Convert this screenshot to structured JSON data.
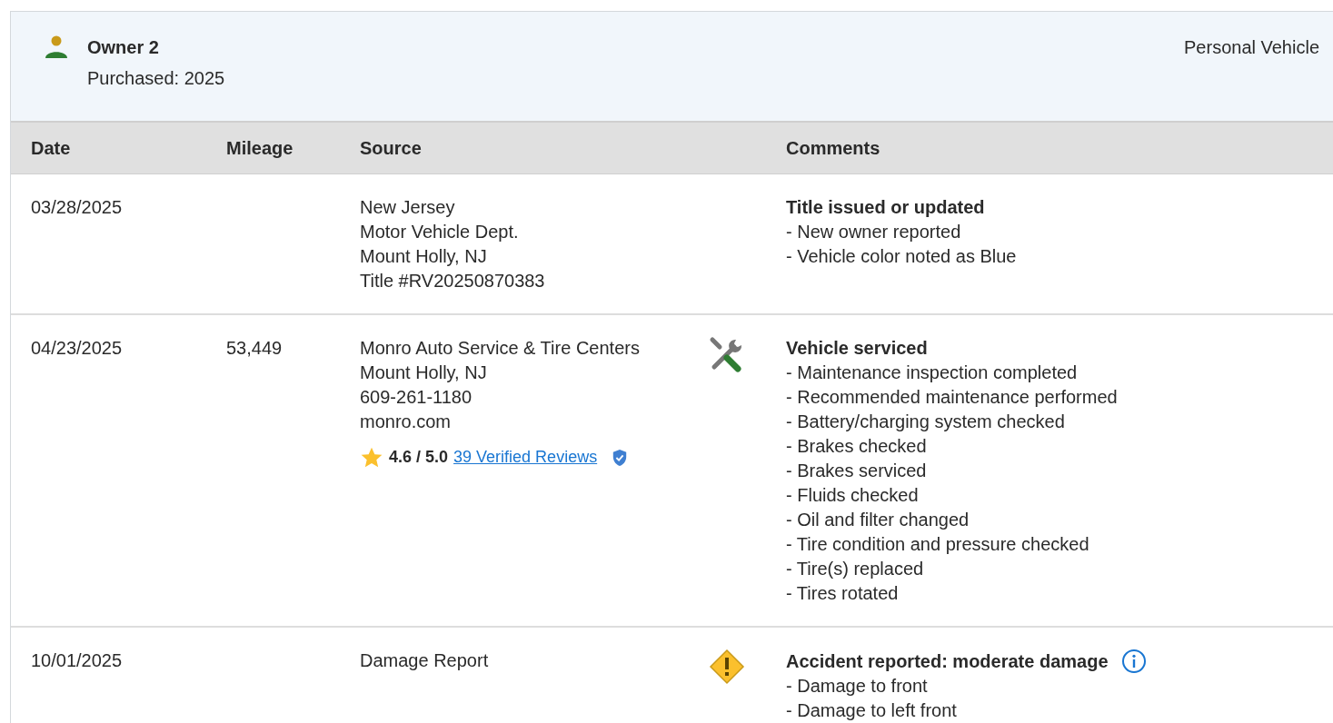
{
  "owner": {
    "title": "Owner 2",
    "purchased": "Purchased: 2025",
    "vehicle_type": "Personal Vehicle"
  },
  "table": {
    "columns": [
      "Date",
      "Mileage",
      "Source",
      "Comments"
    ],
    "rows": [
      {
        "date": "03/28/2025",
        "mileage": "",
        "source": [
          "New Jersey",
          "Motor Vehicle Dept.",
          "Mount Holly, NJ",
          "Title #RV20250870383"
        ],
        "kind": "title",
        "comment_title": "Title issued or updated",
        "comments": [
          "- New owner reported",
          "- Vehicle color noted as Blue"
        ]
      },
      {
        "date": "04/23/2025",
        "mileage": "53,449",
        "source": [
          "Monro Auto Service & Tire Centers",
          "Mount Holly, NJ",
          "609-261-1180",
          "monro.com"
        ],
        "rating": {
          "score": "4.6 / 5.0",
          "reviews": "39 Verified Reviews"
        },
        "kind": "service",
        "comment_title": "Vehicle serviced",
        "comments": [
          "- Maintenance inspection completed",
          "- Recommended maintenance performed",
          "- Battery/charging system checked",
          "- Brakes checked",
          "- Brakes serviced",
          "- Fluids checked",
          "- Oil and filter changed",
          "- Tire condition and pressure checked",
          "- Tire(s) replaced",
          "- Tires rotated"
        ]
      },
      {
        "date": "10/01/2025",
        "mileage": "",
        "source": [
          "Damage Report"
        ],
        "kind": "damage",
        "comment_title": "Accident reported: moderate damage",
        "info": true,
        "comments": [
          "- Damage to front",
          "- Damage to left front"
        ]
      }
    ]
  }
}
